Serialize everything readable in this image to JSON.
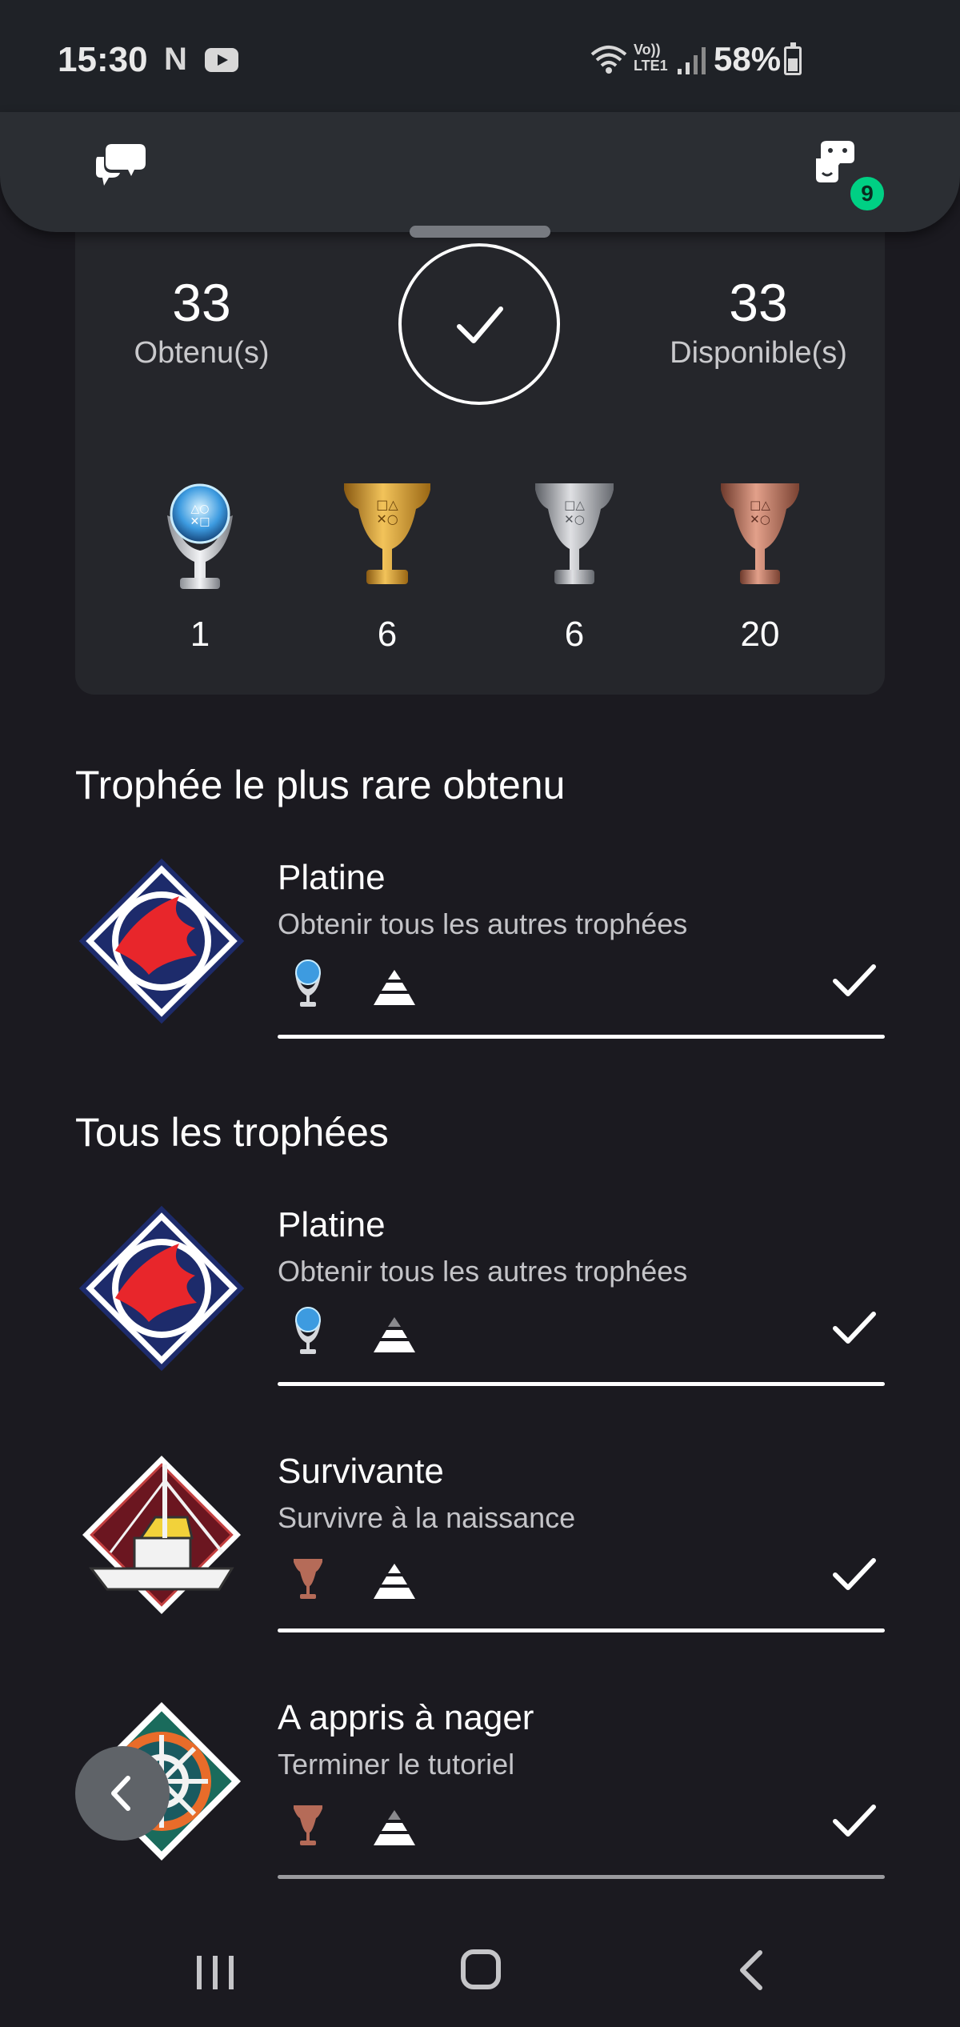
{
  "status_bar": {
    "time": "15:30",
    "notification_letter": "N",
    "network_label_top": "Vo))",
    "network_label_bottom": "LTE1",
    "battery": "58%"
  },
  "app_bar": {
    "left_icon": "chat-bubbles-icon",
    "right_icon": "game-controller-icon",
    "badge_count": "9",
    "badge_color": "#00d084"
  },
  "summary": {
    "earned_count": "33",
    "earned_label": "Obtenu(s)",
    "available_count": "33",
    "available_label": "Disponible(s)",
    "trophy_counts": [
      {
        "grade": "platinum",
        "count": "1"
      },
      {
        "grade": "gold",
        "count": "6"
      },
      {
        "grade": "silver",
        "count": "6"
      },
      {
        "grade": "bronze",
        "count": "20"
      }
    ]
  },
  "rarest": {
    "section_title": "Trophée le plus rare obtenu",
    "trophy": {
      "name": "Platine",
      "description": "Obtenir tous les autres trophées",
      "grade": "platinum",
      "earned": true
    }
  },
  "all_trophies": {
    "section_title": "Tous les trophées",
    "items": [
      {
        "name": "Platine",
        "description": "Obtenir tous les autres trophées",
        "grade": "platinum",
        "earned": true
      },
      {
        "name": "Survivante",
        "description": "Survivre à la naissance",
        "grade": "bronze",
        "earned": true
      },
      {
        "name": "A appris à nager",
        "description": "Terminer le tutoriel",
        "grade": "bronze",
        "earned": true
      }
    ]
  },
  "colors": {
    "background": "#1b1a20",
    "card": "#25262b",
    "platinum": "#8fd0f4",
    "gold": "#d89b2b",
    "silver": "#a9aaae",
    "bronze": "#b56b58"
  }
}
